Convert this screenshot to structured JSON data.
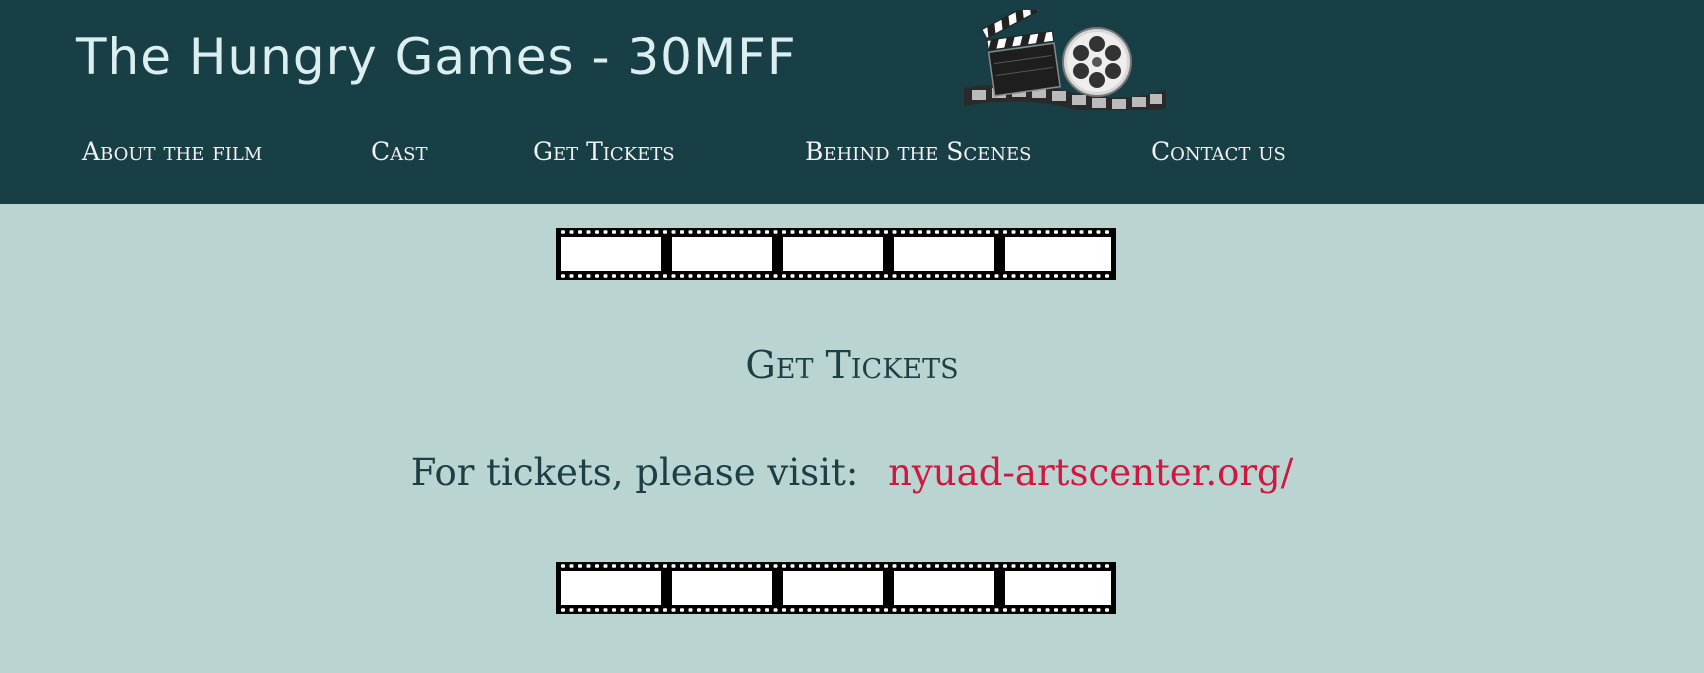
{
  "header": {
    "title": "The Hungry Games - 30MFF",
    "logo_icon": "film-clapperboard-reel-icon",
    "background": "#193f46"
  },
  "nav": {
    "items": [
      {
        "label": "About the film"
      },
      {
        "label": "Cast"
      },
      {
        "label": "Get Tickets"
      },
      {
        "label": "Behind the Scenes"
      },
      {
        "label": "Contact us"
      }
    ]
  },
  "main": {
    "heading": "Get Tickets",
    "ticket_text": "For tickets, please visit:",
    "ticket_link": "nyuad-artscenter.org/",
    "divider_icon": "filmstrip-icon",
    "background": "#bad5d1",
    "link_color": "#d1173f"
  }
}
